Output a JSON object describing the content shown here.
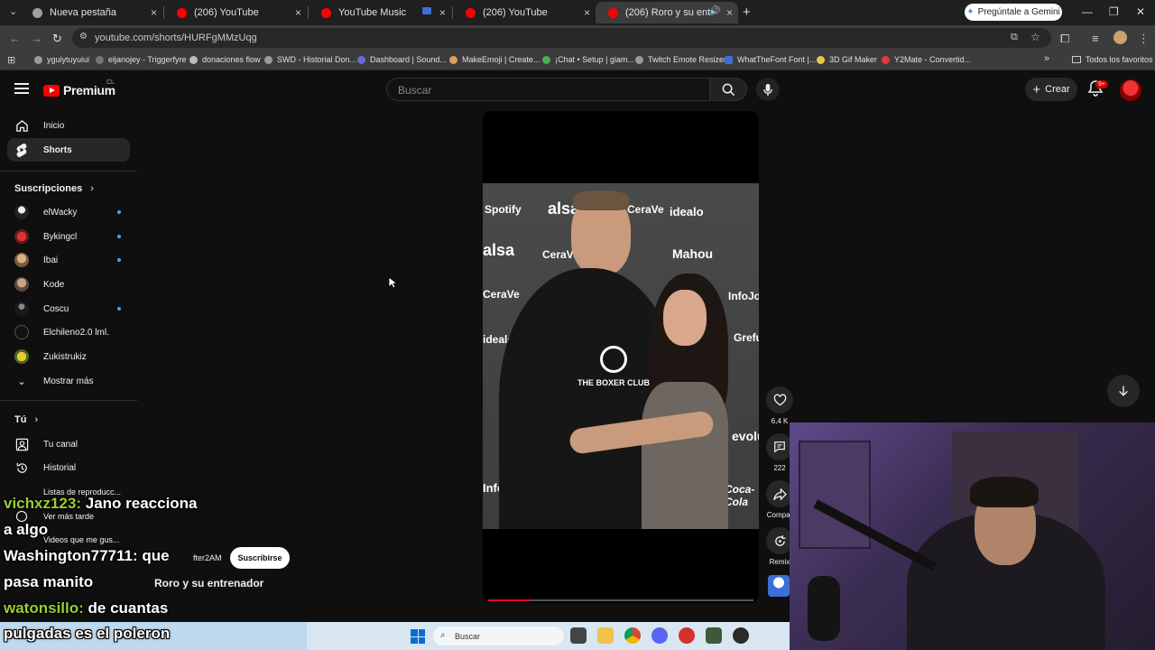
{
  "browser": {
    "tabs": [
      {
        "title": "Nueva pestaña"
      },
      {
        "title": "(206) YouTube"
      },
      {
        "title": "YouTube Music"
      },
      {
        "title": "(206) YouTube"
      },
      {
        "title": "(206) Roro y su entrenador"
      }
    ],
    "gemini_label": "Pregúntale a Gemini",
    "url": "youtube.com/shorts/HURFgMMzUqg",
    "bookmarks": [
      "yguiytuyuiui",
      "eljanojey - Triggerfyre",
      "donaciones flow",
      "SWD - Historial Don...",
      "Dashboard | Sound...",
      "MakeEmoji | Create...",
      "¡Chat • Setup | giam...",
      "Twitch Emote Resizer",
      "WhatTheFont Font |...",
      "3D Gif Maker",
      "Y2Mate - Convertid..."
    ],
    "all_bookmarks": "Todos los favoritos"
  },
  "youtube": {
    "logo_text": "Premium",
    "logo_region": "CL",
    "search_placeholder": "Buscar",
    "create_label": "Crear",
    "notif_badge": "9+",
    "sidebar": {
      "main": [
        {
          "label": "Inicio"
        },
        {
          "label": "Shorts"
        }
      ],
      "subs_heading": "Suscripciones",
      "subscriptions": [
        {
          "label": "elWacky",
          "live": true
        },
        {
          "label": "Bykingcl",
          "live": true
        },
        {
          "label": "Ibai",
          "live": true
        },
        {
          "label": "Kode",
          "live": false
        },
        {
          "label": "Coscu",
          "live": true
        },
        {
          "label": "Elchileno2.0 lml.",
          "live": false
        },
        {
          "label": "Zukistrukiz",
          "live": false
        }
      ],
      "show_more": "Mostrar más",
      "you_heading": "Tú",
      "you_items": [
        {
          "label": "Tu canal"
        },
        {
          "label": "Historial"
        },
        {
          "label": "Listas de reproducc..."
        },
        {
          "label": "Ver más tarde"
        },
        {
          "label": "Videos que me gus..."
        }
      ]
    },
    "short": {
      "channel": "fter2AM",
      "subscribe_label": "Suscribirse",
      "title": "Roro y su entrenador",
      "likes": "6,4 K",
      "comments": "222",
      "share_label": "Compar",
      "remix_label": "Remix",
      "progress": 0.16,
      "brands": [
        "Spotify",
        "alsa",
        "CeraVe",
        "idealo",
        "Mahou",
        "InfoJobs",
        "Coca-Cola",
        "THE BOXER CLUB",
        "Grefusa",
        "evolu"
      ]
    }
  },
  "chat": [
    {
      "user": "vichxz123",
      "msg": "Jano reacciona"
    },
    {
      "user": "",
      "msg": "a algo"
    },
    {
      "user": "Washington77711",
      "msg": "que"
    },
    {
      "user": "",
      "msg": "pasa manito"
    },
    {
      "user": "watonsillo",
      "msg": "de cuantas"
    },
    {
      "user": "",
      "msg": "pulgadas es el poleron"
    }
  ],
  "taskbar": {
    "search_label": "Buscar"
  },
  "colors": {
    "yt_red": "#ff0000",
    "accent_blue": "#3ea6ff",
    "chat_user": "#9acd32"
  }
}
